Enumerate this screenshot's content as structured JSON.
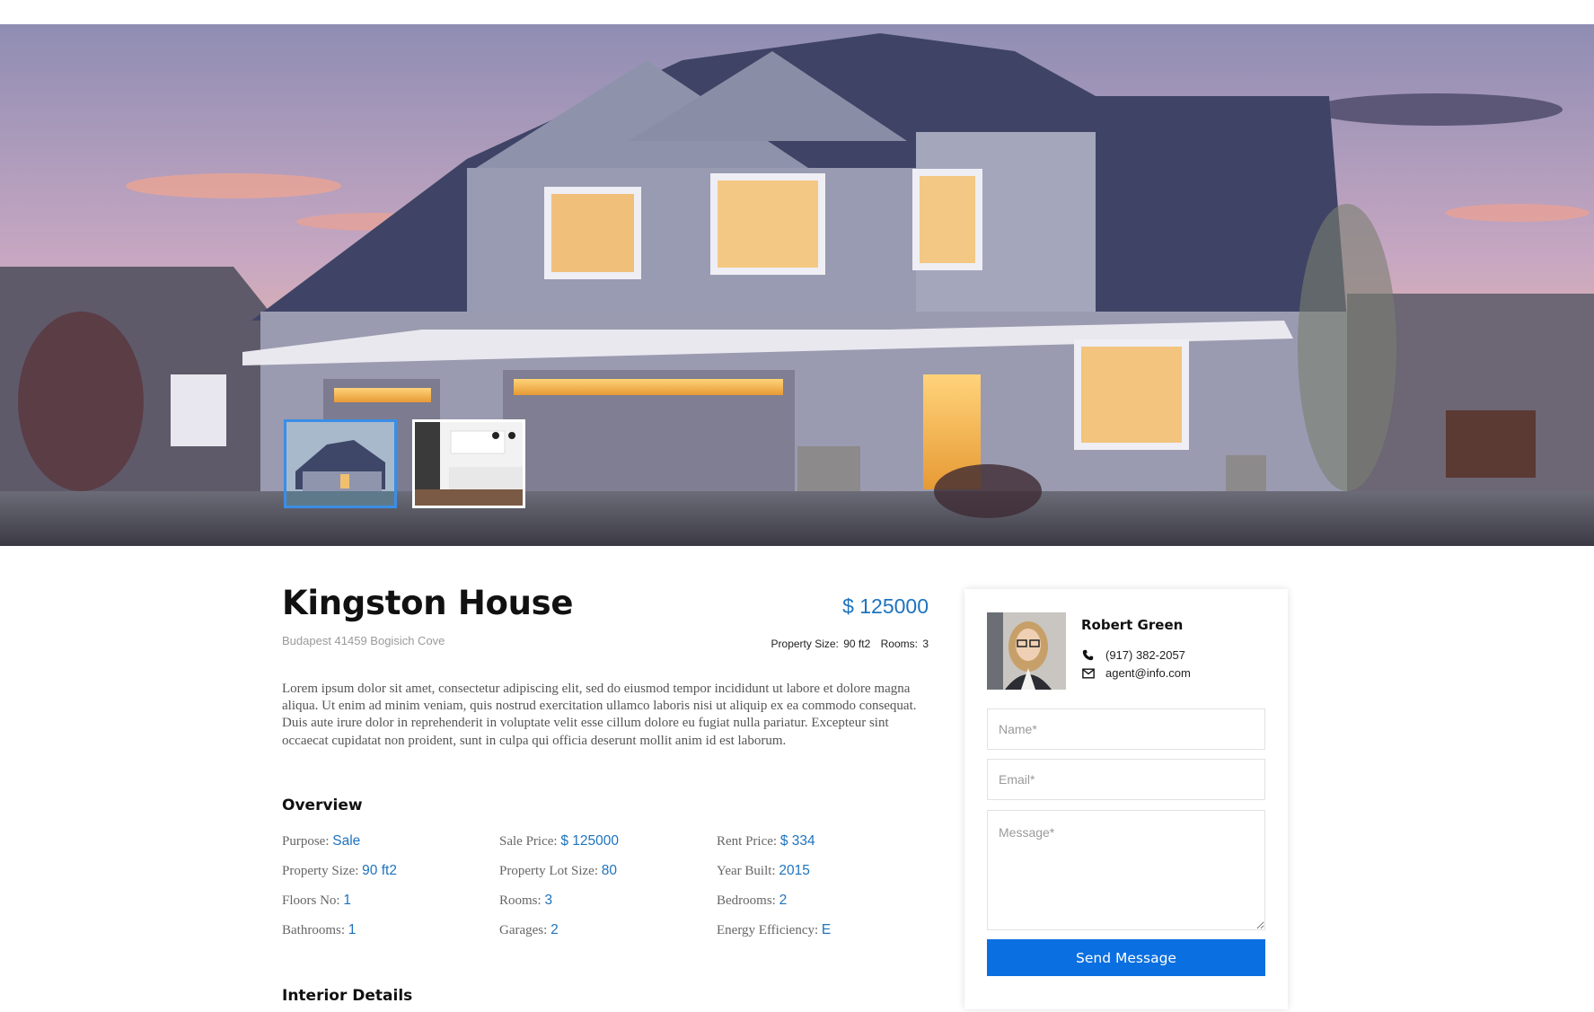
{
  "gallery": {
    "thumbnails": [
      {
        "name": "house-exterior",
        "active": true
      },
      {
        "name": "kitchen-interior",
        "active": false
      }
    ]
  },
  "property": {
    "title": "Kingston House",
    "address": "Budapest 41459 Bogisich Cove",
    "price": "$ 125000",
    "size_label": "Property Size:",
    "size_value": "90 ft2",
    "rooms_label": "Rooms:",
    "rooms_value": "3",
    "description": "Lorem ipsum dolor sit amet, consectetur adipiscing elit, sed do eiusmod tempor incididunt ut labore et dolore magna aliqua. Ut enim ad minim veniam, quis nostrud exercitation ullamco laboris nisi ut aliquip ex ea commodo consequat. Duis aute irure dolor in reprehenderit in voluptate velit esse cillum dolore eu fugiat nulla pariatur. Excepteur sint occaecat cupidatat non proident, sunt in culpa qui officia deserunt mollit anim id est laborum."
  },
  "overview": {
    "heading": "Overview",
    "items": [
      {
        "label": "Purpose:",
        "value": "Sale"
      },
      {
        "label": "Sale Price:",
        "value": "$ 125000"
      },
      {
        "label": "Rent Price:",
        "value": "$ 334"
      },
      {
        "label": "Property Size:",
        "value": "90 ft2"
      },
      {
        "label": "Property Lot Size:",
        "value": "80"
      },
      {
        "label": "Year Built:",
        "value": "2015"
      },
      {
        "label": "Floors No:",
        "value": "1"
      },
      {
        "label": "Rooms:",
        "value": "3"
      },
      {
        "label": "Bedrooms:",
        "value": "2"
      },
      {
        "label": "Bathrooms:",
        "value": "1"
      },
      {
        "label": "Garages:",
        "value": "2"
      },
      {
        "label": "Energy Efficiency:",
        "value": "E"
      }
    ]
  },
  "interior": {
    "heading": "Interior Details"
  },
  "agent": {
    "name": "Robert Green",
    "phone": "(917) 382-2057",
    "email": "agent@info.com",
    "phone_icon": "phone-icon",
    "email_icon": "envelope-icon"
  },
  "form": {
    "name_placeholder": "Name*",
    "email_placeholder": "Email*",
    "message_placeholder": "Message*",
    "submit_label": "Send Message"
  },
  "colors": {
    "accent": "#1e73be",
    "button": "#0a6fe0",
    "active_thumb_border": "#3a8ee6"
  }
}
